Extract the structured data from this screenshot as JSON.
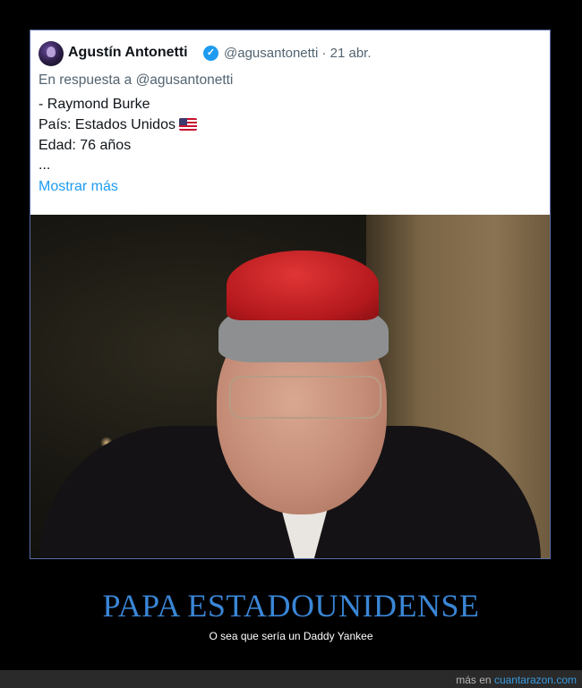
{
  "tweet": {
    "author_name": "Agustín Antonetti",
    "handle_and_date": "@agusantonetti · 21 abr.",
    "reply_to": "En respuesta a @agusantonetti",
    "lines": [
      "- Raymond Burke",
      "País: Estados Unidos",
      "Edad: 76 años",
      "..."
    ],
    "show_more": "Mostrar más"
  },
  "meme": {
    "headline": "PAPA ESTADOUNIDENSE",
    "caption": "O sea que sería un Daddy Yankee"
  },
  "footer": {
    "prefix": "más en",
    "site": "cuantarazon.com"
  },
  "icons": {
    "verified": "verified-badge-icon",
    "flag": "us-flag-icon"
  },
  "colors": {
    "headline": "#3a86d6",
    "link": "#1d9bf0",
    "verified": "#1d9bf0"
  }
}
